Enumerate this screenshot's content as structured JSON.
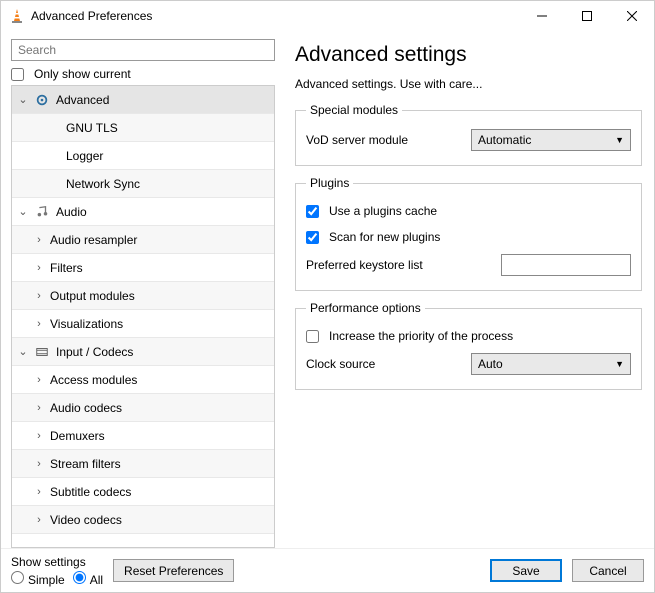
{
  "window": {
    "title": "Advanced Preferences"
  },
  "search": {
    "placeholder": "Search"
  },
  "only_show_current": "Only show current",
  "tree": {
    "advanced": "Advanced",
    "gnu_tls": "GNU TLS",
    "logger": "Logger",
    "network_sync": "Network Sync",
    "audio": "Audio",
    "audio_resampler": "Audio resampler",
    "filters": "Filters",
    "output_modules": "Output modules",
    "visualizations": "Visualizations",
    "input_codecs": "Input / Codecs",
    "access_modules": "Access modules",
    "audio_codecs": "Audio codecs",
    "demuxers": "Demuxers",
    "stream_filters": "Stream filters",
    "subtitle_codecs": "Subtitle codecs",
    "video_codecs": "Video codecs"
  },
  "right": {
    "title": "Advanced settings",
    "subtitle": "Advanced settings. Use with care...",
    "special_modules": {
      "legend": "Special modules",
      "vod_label": "VoD server module",
      "vod_value": "Automatic"
    },
    "plugins": {
      "legend": "Plugins",
      "use_cache": "Use a plugins cache",
      "scan_new": "Scan for new plugins",
      "keystore_label": "Preferred keystore list",
      "keystore_value": ""
    },
    "performance": {
      "legend": "Performance options",
      "increase_priority": "Increase the priority of the process",
      "clock_label": "Clock source",
      "clock_value": "Auto"
    }
  },
  "footer": {
    "show_settings": "Show settings",
    "simple": "Simple",
    "all": "All",
    "reset": "Reset Preferences",
    "save": "Save",
    "cancel": "Cancel"
  }
}
